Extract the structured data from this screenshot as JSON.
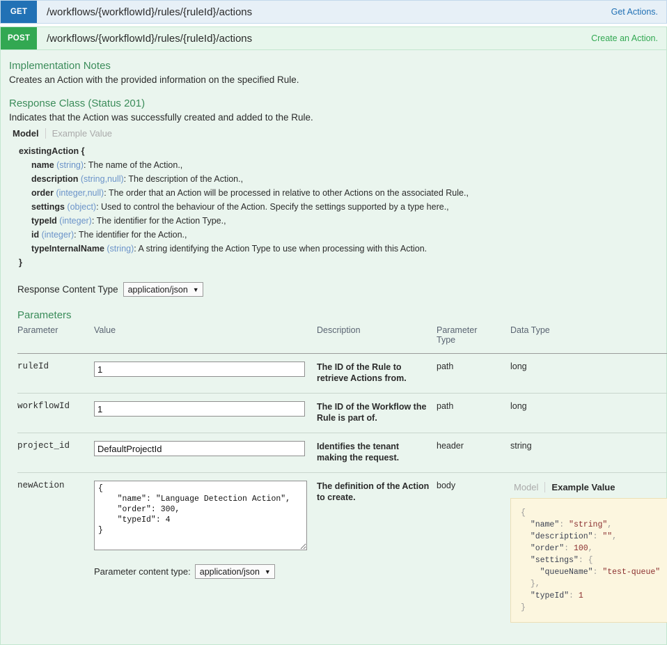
{
  "operations": [
    {
      "method": "GET",
      "path": "/workflows/{workflowId}/rules/{ruleId}/actions",
      "summary": "Get Actions.",
      "color": "#2171b5"
    },
    {
      "method": "POST",
      "path": "/workflows/{workflowId}/rules/{ruleId}/actions",
      "summary": "Create an Action.",
      "color": "#32a852"
    }
  ],
  "details": {
    "implementation_notes_title": "Implementation Notes",
    "implementation_notes_text": "Creates an Action with the provided information on the specified Rule.",
    "response_class_title": "Response Class (Status 201)",
    "response_class_text": "Indicates that the Action was successfully created and added to the Rule.",
    "tabs": {
      "model": "Model",
      "example_value": "Example Value"
    },
    "model": {
      "name": "existingAction {",
      "close": "}",
      "properties": [
        {
          "name": "name",
          "type": "(string)",
          "desc": ": The name of the Action.,"
        },
        {
          "name": "description",
          "type": "(string,null)",
          "desc": ": The description of the Action.,"
        },
        {
          "name": "order",
          "type": "(integer,null)",
          "desc": ": The order that an Action will be processed in relative to other Actions on the associated Rule.,"
        },
        {
          "name": "settings",
          "type": "(object)",
          "desc": ": Used to control the behaviour of the Action. Specify the settings supported by a type here.,"
        },
        {
          "name": "typeId",
          "type": "(integer)",
          "desc": ": The identifier for the Action Type.,"
        },
        {
          "name": "id",
          "type": "(integer)",
          "desc": ": The identifier for the Action.,"
        },
        {
          "name": "typeInternalName",
          "type": "(string)",
          "desc": ": A string identifying the Action Type to use when processing with this Action."
        }
      ]
    },
    "response_content_type": {
      "label": "Response Content Type",
      "value": "application/json"
    }
  },
  "parameters": {
    "title": "Parameters",
    "headers": {
      "parameter": "Parameter",
      "value": "Value",
      "description": "Description",
      "parameter_type": "Parameter Type",
      "data_type": "Data Type"
    },
    "rows": [
      {
        "name": "ruleId",
        "value": "1",
        "description": "The ID of the Rule to retrieve Actions from.",
        "param_type": "path",
        "data_type": "long"
      },
      {
        "name": "workflowId",
        "value": "1",
        "description": "The ID of the Workflow the Rule is part of.",
        "param_type": "path",
        "data_type": "long"
      },
      {
        "name": "project_id",
        "value": "DefaultProjectId",
        "description": "Identifies the tenant making the request.",
        "param_type": "header",
        "data_type": "string"
      }
    ],
    "body_row": {
      "name": "newAction",
      "value": "{\n    \"name\": \"Language Detection Action\",\n    \"order\": 300,\n    \"typeId\": 4\n}",
      "description": "The definition of the Action to create.",
      "param_type": "body",
      "content_type_label": "Parameter content type:",
      "content_type_value": "application/json",
      "example_tabs": {
        "model": "Model",
        "example_value": "Example Value"
      },
      "example_value": {
        "open": "{",
        "lines": [
          {
            "key": "\"name\"",
            "value": "\"string\"",
            "kind": "string",
            "comma": ","
          },
          {
            "key": "\"description\"",
            "value": "\"\"",
            "kind": "string",
            "comma": ","
          },
          {
            "key": "\"order\"",
            "value": "100",
            "kind": "number",
            "comma": ","
          },
          {
            "key": "\"settings\"",
            "value": "{",
            "kind": "object",
            "comma": ""
          },
          {
            "key": "\"queueName\"",
            "value": "\"test-queue\"",
            "kind": "string",
            "comma": "",
            "indent": 2
          },
          {
            "key": "",
            "value": "},",
            "kind": "raw",
            "comma": ""
          },
          {
            "key": "\"typeId\"",
            "value": "1",
            "kind": "number",
            "comma": ""
          }
        ],
        "close": "}"
      }
    }
  },
  "icons": {
    "caret": "▼",
    "resize_handle": "resize-grip"
  }
}
